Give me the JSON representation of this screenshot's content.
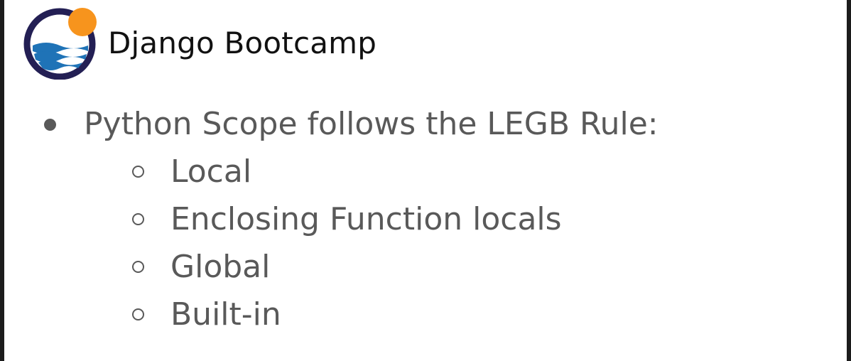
{
  "header": {
    "brand": "Django Bootcamp",
    "logo_colors": {
      "ring": "#231f54",
      "sun": "#f7941d",
      "waves": "#1f73b7"
    }
  },
  "content": {
    "bullet": "Python Scope follows the LEGB Rule:",
    "sub_items": [
      {
        "label": "Local"
      },
      {
        "label": "Enclosing Function locals"
      },
      {
        "label": "Global"
      },
      {
        "label": "Built-in"
      }
    ]
  },
  "colors": {
    "text": "#595959",
    "background": "#ffffff"
  }
}
